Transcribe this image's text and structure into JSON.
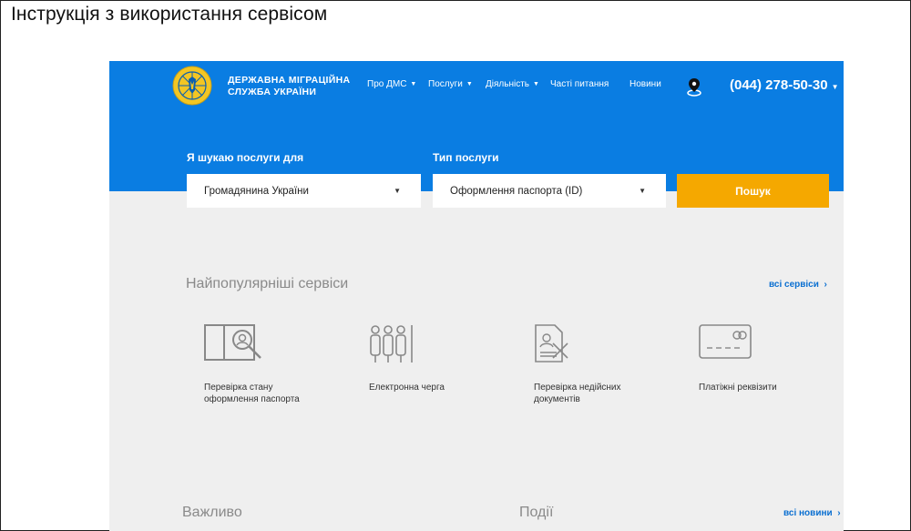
{
  "doc": {
    "title": "Інструкція з використання сервісом"
  },
  "header": {
    "brand_line1": "ДЕРЖАВНА МІГРАЦІЙНА",
    "brand_line2": "СЛУЖБА УКРАЇНИ",
    "nav": [
      {
        "label": "Про ДМС",
        "has_dropdown": true
      },
      {
        "label": "Послуги",
        "has_dropdown": true
      },
      {
        "label": "Діяльність",
        "has_dropdown": true
      },
      {
        "label": "Часті питання",
        "has_dropdown": false
      },
      {
        "label": "Новини",
        "has_dropdown": false
      }
    ],
    "location_icon": "map-pin-icon",
    "phone": "(044) 278-50-30"
  },
  "search": {
    "for_label": "Я шукаю послуги для",
    "for_value": "Громадянина України",
    "type_label": "Тип послуги",
    "type_value": "Оформлення паспорта (ID)",
    "button_label": "Пошук"
  },
  "popular": {
    "title": "Найпопулярніші сервіси",
    "all_link": "всі сервіси",
    "services": [
      {
        "icon": "passport-search-icon",
        "line1": "Перевірка стану",
        "line2": "оформлення паспорта"
      },
      {
        "icon": "queue-icon",
        "line1": "Електронна черга",
        "line2": ""
      },
      {
        "icon": "invalid-document-icon",
        "line1": "Перевірка недійсних",
        "line2": "документів"
      },
      {
        "icon": "payment-card-icon",
        "line1": "Платіжні реквізити",
        "line2": ""
      }
    ]
  },
  "bottom": {
    "important_title": "Важливо",
    "events_title": "Події",
    "all_news_link": "всі новини"
  },
  "colors": {
    "blue": "#0a7de2",
    "accent": "#f5a800",
    "link": "#0a6fd1"
  }
}
